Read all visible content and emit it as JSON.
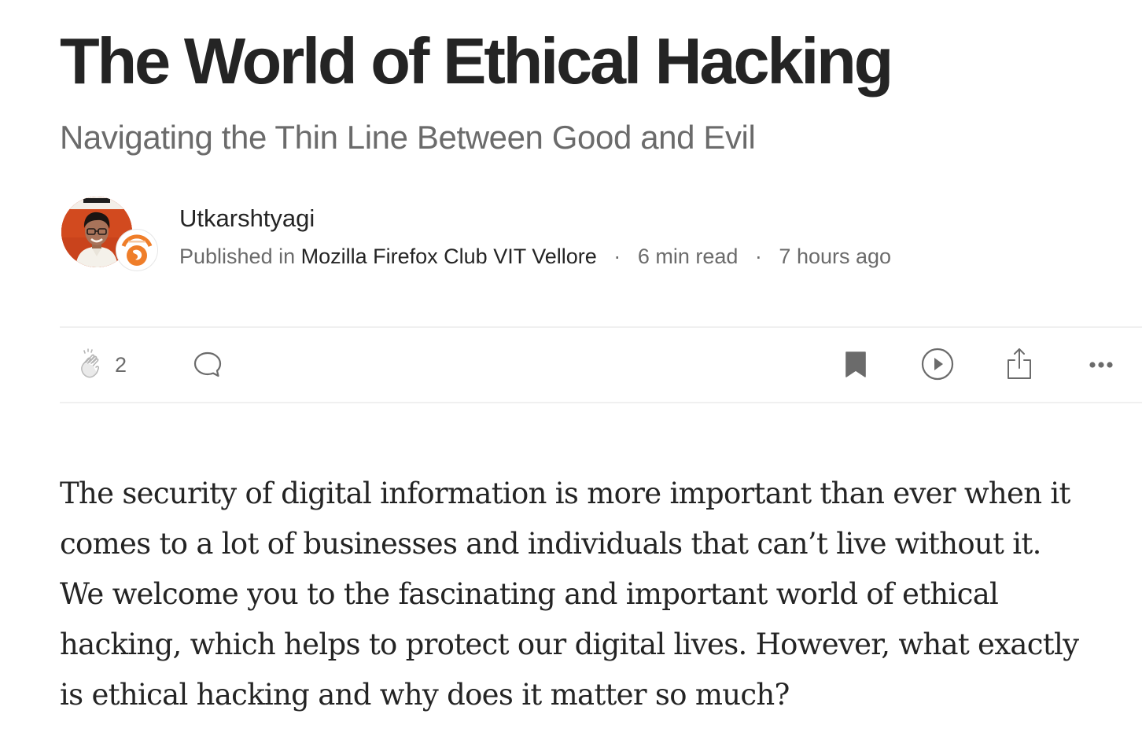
{
  "article": {
    "title": "The World of Ethical Hacking",
    "subtitle": "Navigating the Thin Line Between Good and Evil",
    "author": {
      "name": "Utkarshtyagi",
      "avatar_icon": "author-photo"
    },
    "publication": {
      "prefix": "Published in",
      "name": "Mozilla Firefox Club VIT Vellore",
      "logo_icon": "firefox-club-logo"
    },
    "separator": "·",
    "read_time": "6 min read",
    "published_ago": "7 hours ago",
    "body": "The security of digital information is more important than ever when it comes to a lot of businesses and individuals that can’t live without it. We welcome you to the fascinating and important world of ethical hacking, which helps to protect our digital lives. However, what exactly is ethical hacking and why does it matter so much?"
  },
  "actions": {
    "clap_icon": "clap-icon",
    "clap_count": "2",
    "comment_icon": "comment-icon",
    "bookmark_icon": "bookmark-icon",
    "listen_icon": "play-icon",
    "share_icon": "share-icon",
    "more_icon": "more-icon"
  },
  "colors": {
    "text_primary": "#242424",
    "text_secondary": "#6b6b6b",
    "divider": "#f0f0f0",
    "icon": "#6b6b6b"
  }
}
